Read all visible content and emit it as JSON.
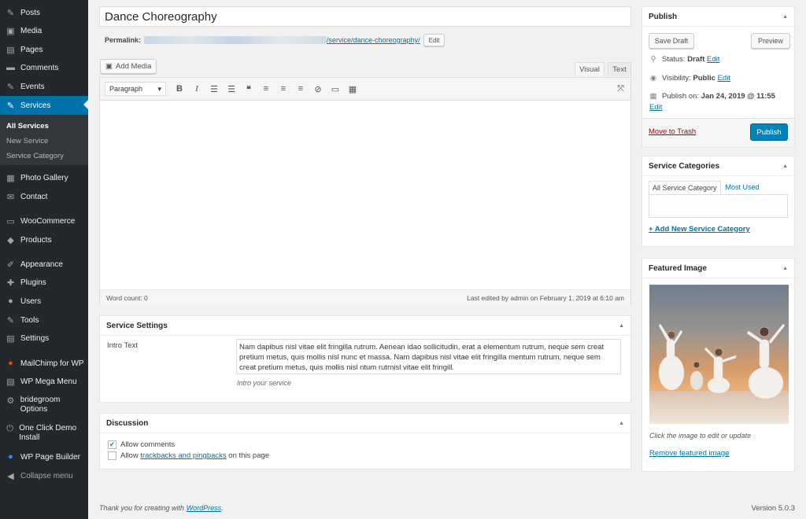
{
  "menu": {
    "items": [
      {
        "label": "Posts",
        "icon": "pin-icon",
        "glyph": "✎"
      },
      {
        "label": "Media",
        "icon": "media-icon",
        "glyph": "▣"
      },
      {
        "label": "Pages",
        "icon": "pages-icon",
        "glyph": "▤"
      },
      {
        "label": "Comments",
        "icon": "comments-icon",
        "glyph": "▬"
      },
      {
        "label": "Events",
        "icon": "events-icon",
        "glyph": "✎"
      },
      {
        "label": "Services",
        "icon": "services-icon",
        "glyph": "✎"
      }
    ],
    "submenu": [
      "All Services",
      "New Service",
      "Service Category"
    ],
    "items2": [
      {
        "label": "Photo Gallery",
        "icon": "gallery-icon",
        "glyph": "▦"
      },
      {
        "label": "Contact",
        "icon": "contact-icon",
        "glyph": "✉"
      },
      {
        "label": "WooCommerce",
        "icon": "woocommerce-icon",
        "glyph": "▭"
      },
      {
        "label": "Products",
        "icon": "products-icon",
        "glyph": "◆"
      },
      {
        "label": "Appearance",
        "icon": "appearance-icon",
        "glyph": "✐"
      },
      {
        "label": "Plugins",
        "icon": "plugins-icon",
        "glyph": "✚"
      },
      {
        "label": "Users",
        "icon": "users-icon",
        "glyph": "●"
      },
      {
        "label": "Tools",
        "icon": "tools-icon",
        "glyph": "✎"
      },
      {
        "label": "Settings",
        "icon": "settings-icon",
        "glyph": "▤"
      },
      {
        "label": "MailChimp for WP",
        "icon": "mailchimp-icon",
        "glyph": "●"
      },
      {
        "label": "WP Mega Menu",
        "icon": "megamenu-icon",
        "glyph": "▤"
      },
      {
        "label": "bridegroom Options",
        "icon": "gear-icon",
        "glyph": "⚙"
      },
      {
        "label": "One Click Demo Install",
        "icon": "demo-icon",
        "glyph": "⏻"
      },
      {
        "label": "WP Page Builder",
        "icon": "pagebuilder-icon",
        "glyph": "●"
      },
      {
        "label": "Collapse menu",
        "icon": "collapse-icon",
        "glyph": "◀"
      }
    ]
  },
  "post": {
    "title": "Dance Choreography"
  },
  "permalink": {
    "label": "Permalink:",
    "slug": "/service/dance-choreography/",
    "edit": "Edit"
  },
  "editor": {
    "add_media": "Add Media",
    "tab_visual": "Visual",
    "tab_text": "Text",
    "format": "Paragraph",
    "word_count": "Word count: 0",
    "last_edited": "Last edited by admin on February 1, 2019 at 6:10 am"
  },
  "service_settings": {
    "title": "Service Settings",
    "intro_label": "Intro Text",
    "intro_value": "Nam dapibus nisl vitae elit fringilla rutrum. Aenean idao sollicitudin, erat a elementum rutrum, neque sem creat pretium metus, quis mollis nisl nunc et massa. Nam dapibus nisl vitae elit fringilla mentum rutrum, neque sem creat pretium metus, quis mollis nisl ntum rutrnisl vitae elit fringill.",
    "intro_desc": "Intro your service"
  },
  "discussion": {
    "title": "Discussion",
    "allow_comments": "Allow comments",
    "allow_prefix": "Allow",
    "trackbacks_link": "trackbacks and pingbacks",
    "allow_suffix": "on this page",
    "comments_checked": true,
    "trackbacks_checked": false
  },
  "publish": {
    "title": "Publish",
    "save_draft": "Save Draft",
    "preview": "Preview",
    "status_label": "Status:",
    "status_value": "Draft",
    "visibility_label": "Visibility:",
    "visibility_value": "Public",
    "publish_on_label": "Publish on:",
    "publish_on_value": "Jan 24, 2019 @ 11:55",
    "edit": "Edit",
    "trash": "Move to Trash",
    "publish": "Publish"
  },
  "categories": {
    "title": "Service Categories",
    "tab_all": "All Service Category",
    "tab_most": "Most Used",
    "add_new": "+ Add New Service Category"
  },
  "featured": {
    "title": "Featured Image",
    "caption": "Click the image to edit or update",
    "remove": "Remove featured image"
  },
  "footer": {
    "thanks_prefix": "Thank you for creating with",
    "wordpress": "WordPress",
    "thanks_suffix": ".",
    "version": "Version 5.0.3"
  }
}
